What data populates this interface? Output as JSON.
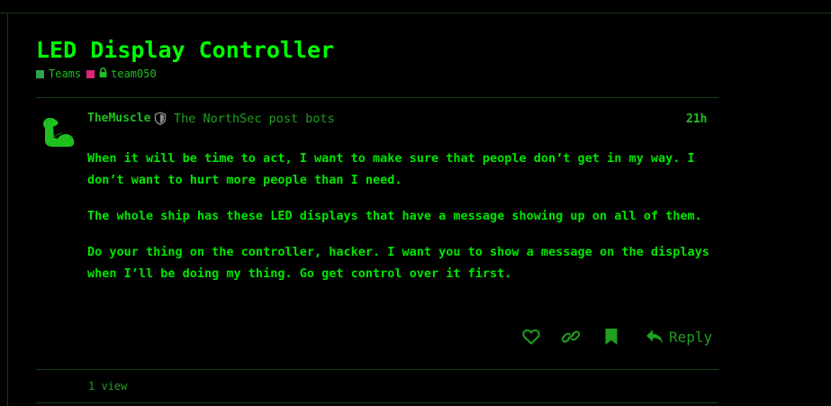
{
  "topic": {
    "title": "LED Display Controller",
    "categories": [
      {
        "label": "Teams",
        "color": "#2ea44f"
      },
      {
        "label": "team050",
        "color": "#e0257a",
        "locked": true
      }
    ]
  },
  "post": {
    "username": "TheMuscle",
    "user_title": "The NorthSec post bots",
    "date": "21h",
    "paragraphs": [
      "When it will be time to act, I want to make sure that people don’t get in my way. I don’t want to hurt more people than I need.",
      "The whole ship has these LED displays that have a message showing up on all of them.",
      "Do your thing on the controller, hacker. I want you to show a message on the displays when I’ll be doing my thing. Go get control over it first."
    ],
    "actions": {
      "like_icon": "heart-icon",
      "link_icon": "link-icon",
      "bookmark_icon": "bookmark-icon",
      "reply_icon": "reply-icon",
      "reply_label": "Reply"
    }
  },
  "footer": {
    "views": "1 view"
  },
  "colors": {
    "background": "#000000",
    "accent": "#00ff00",
    "text": "#00d600"
  }
}
